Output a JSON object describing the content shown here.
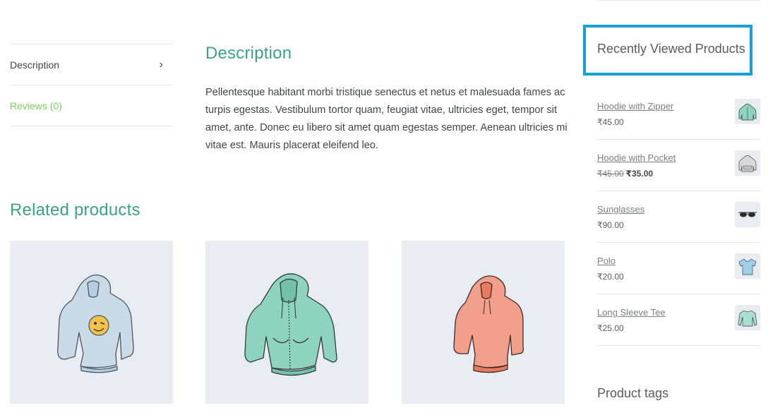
{
  "tabs": [
    {
      "label": "Description",
      "chevron": "›"
    },
    {
      "label": "Reviews (0)"
    }
  ],
  "description": {
    "heading": "Description",
    "text": "Pellentesque habitant morbi tristique senectus et netus et malesuada fames ac turpis egestas. Vestibulum tortor quam, feugiat vitae, ultricies eget, tempor sit amet, ante. Donec eu libero sit amet quam egestas semper. Aenean ultricies mi vitae est. Mauris placerat eleifend leo."
  },
  "related": {
    "heading": "Related products",
    "products": [
      {
        "image": "light-blue-hoodie-with-emoji-logo",
        "color": "#c9dbe6"
      },
      {
        "image": "mint-green-zip-hoodie",
        "color": "#8ed3bd"
      },
      {
        "image": "coral-hoodie",
        "color": "#f2a08c"
      }
    ]
  },
  "sidebar": {
    "recently_viewed_title": "Recently Viewed Products",
    "items": [
      {
        "name": "Hoodie with Zipper",
        "price": "₹45.00",
        "image": "mint-zip-hoodie-thumb"
      },
      {
        "name": "Hoodie with Pocket",
        "old_price": "₹45.00",
        "sale_price": "₹35.00",
        "image": "grey-pocket-hoodie-thumb"
      },
      {
        "name": "Sunglasses",
        "price": "₹90.00",
        "image": "sunglasses-thumb"
      },
      {
        "name": "Polo",
        "price": "₹20.00",
        "image": "blue-polo-thumb"
      },
      {
        "name": "Long Sleeve Tee",
        "price": "₹25.00",
        "image": "mint-long-sleeve-tee-thumb"
      }
    ],
    "product_tags_title": "Product tags"
  },
  "colors": {
    "accent_heading": "#3aa28e",
    "active_tab": "#7dd05c",
    "highlight_border": "#1a9fd8"
  }
}
